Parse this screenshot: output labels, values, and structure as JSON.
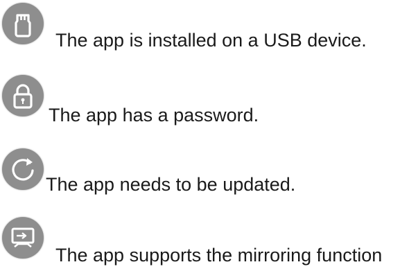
{
  "legend": {
    "items": [
      {
        "icon": "usb-drive-icon",
        "text": "The app is installed on a USB device."
      },
      {
        "icon": "lock-icon",
        "text": "The app has a password."
      },
      {
        "icon": "refresh-icon",
        "text": "The app needs to be updated."
      },
      {
        "icon": "screen-mirroring-icon",
        "text": "The app supports the mirroring function"
      }
    ]
  }
}
